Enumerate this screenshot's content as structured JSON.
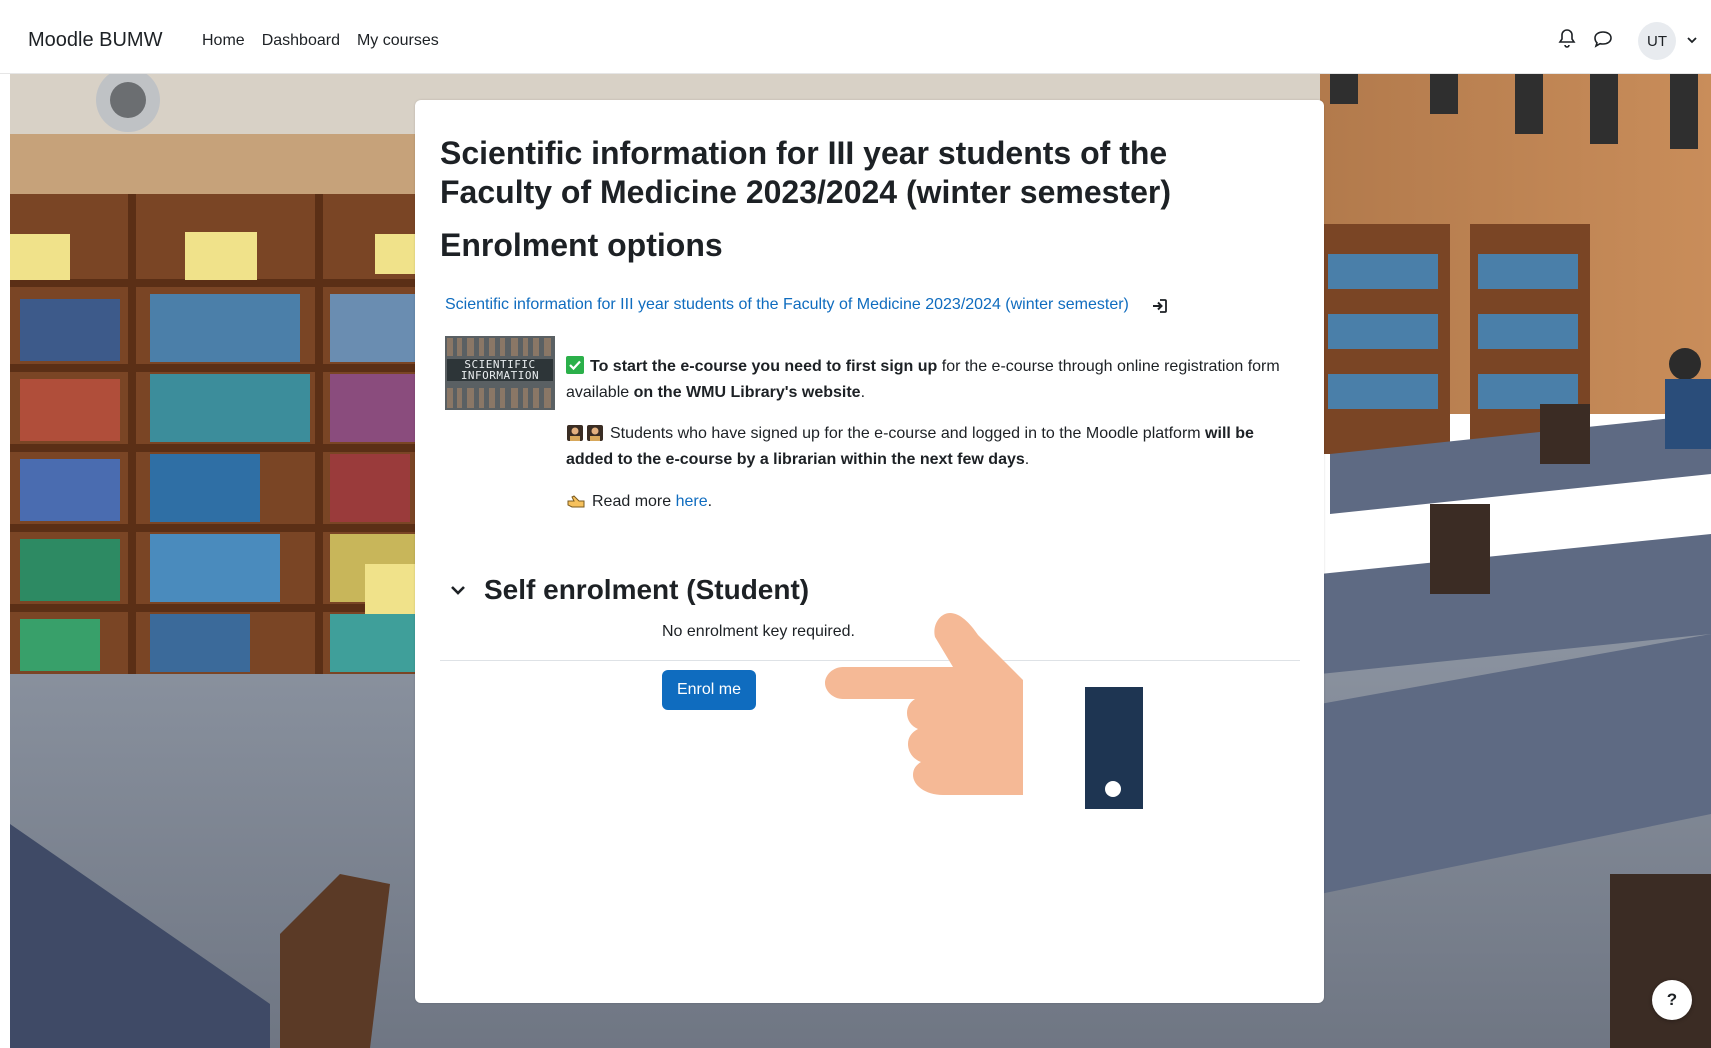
{
  "navbar": {
    "brand": "Moodle BUMW",
    "links": [
      "Home",
      "Dashboard",
      "My courses"
    ],
    "avatar_initials": "UT",
    "icons": [
      "bell-icon",
      "chat-icon",
      "chevron-down-icon"
    ]
  },
  "course": {
    "title": "Scientific information for III year students of the Faculty of Medicine 2023/2024 (winter semester)",
    "page_heading": "Enrolment options",
    "link_text": "Scientific information for III year students of the Faculty of Medicine 2023/2024 (winter semester)",
    "thumbnail_text": "SCIENTIFIC INFORMATION"
  },
  "summary": {
    "p1_bold_start": "To start the e-course you need to first sign up",
    "p1_middle": " for the e-course through online registration form available ",
    "p1_bold_end": "on the WMU Library's website",
    "p1_end": ".",
    "p2_start": "Students who have signed up for the e-course and logged in to the Moodle platform ",
    "p2_bold": "will be added to the e-course by a librarian within the next few days",
    "p2_end": ".",
    "p3_text": "Read more ",
    "p3_link": "here",
    "p3_end": "."
  },
  "self_enrolment": {
    "heading": "Self enrolment (Student)",
    "note": "No enrolment key required.",
    "button_label": "Enrol me"
  },
  "help": {
    "label": "?"
  },
  "colors": {
    "primary": "#0f6cbf",
    "text": "#1d2125",
    "check_green": "#2bb04a"
  }
}
